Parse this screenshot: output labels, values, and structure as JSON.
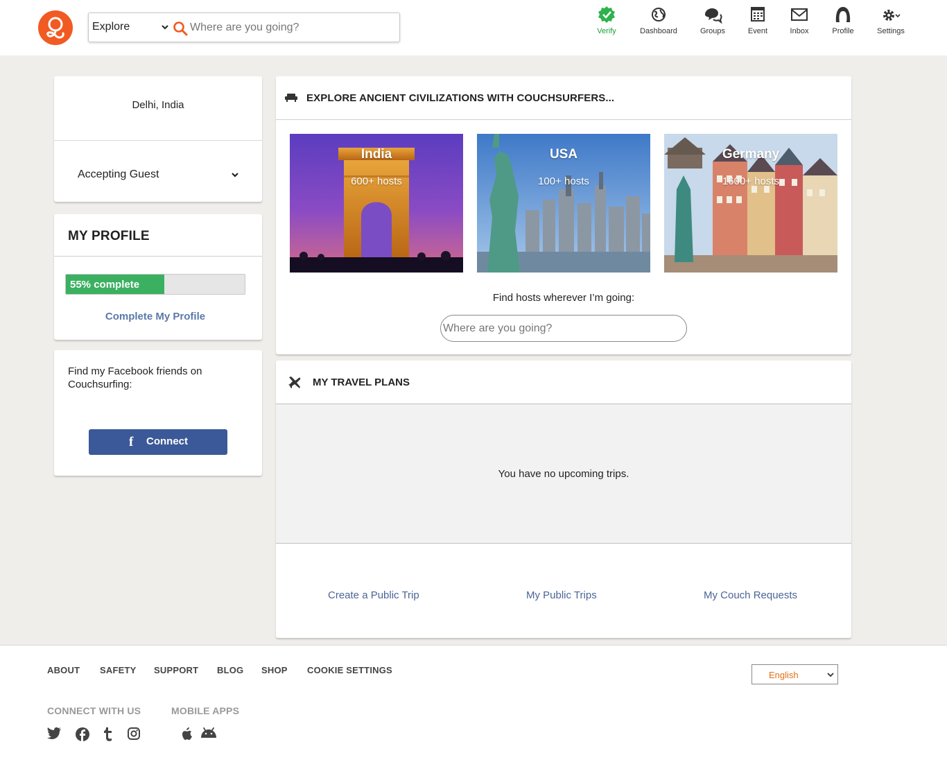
{
  "header": {
    "logo": "couchsurfing-logo",
    "search": {
      "mode_selected": "Explore",
      "placeholder": "Where are you going?"
    },
    "nav": [
      {
        "label": "Verify",
        "icon": "verify-check-icon",
        "color": "#1a9e3c"
      },
      {
        "label": "Dashboard",
        "icon": "globe-icon"
      },
      {
        "label": "Groups",
        "icon": "chat-bubbles-icon"
      },
      {
        "label": "Event",
        "icon": "calendar-icon"
      },
      {
        "label": "Inbox",
        "icon": "envelope-icon"
      },
      {
        "label": "Profile",
        "icon": "user-icon"
      },
      {
        "label": "Settings",
        "icon": "gear-icon"
      }
    ]
  },
  "sidebar": {
    "location": "Delhi, India",
    "hosting_status": "Accepting Guest",
    "profile": {
      "title": "MY PROFILE",
      "progress_percent": 55,
      "progress_label": "55% complete",
      "complete_link": "Complete My Profile"
    },
    "facebook": {
      "text": "Find my Facebook friends on Couchsurfing:",
      "button_label": "Connect"
    }
  },
  "explore": {
    "title": "EXPLORE ANCIENT CIVILIZATIONS WITH COUCHSURFERS...",
    "destinations": [
      {
        "name": "India",
        "hosts": "600+ hosts"
      },
      {
        "name": "USA",
        "hosts": "100+ hosts"
      },
      {
        "name": "Germany",
        "hosts": "1600+ hosts"
      }
    ],
    "find_label": "Find hosts wherever I’m going:",
    "find_placeholder": "Where are you going?"
  },
  "travel_plans": {
    "title": "MY TRAVEL PLANS",
    "empty_message": "You have no upcoming trips.",
    "links": [
      "Create a Public Trip",
      "My Public Trips",
      "My Couch Requests"
    ]
  },
  "footer": {
    "nav": [
      "ABOUT",
      "SAFETY",
      "SUPPORT",
      "BLOG",
      "SHOP",
      "COOKIE SETTINGS"
    ],
    "language": "English",
    "connect_heading": "CONNECT WITH US",
    "apps_heading": "MOBILE APPS",
    "social_icons": [
      "twitter-icon",
      "facebook-icon",
      "tumblr-icon",
      "instagram-icon"
    ],
    "app_icons": [
      "apple-icon",
      "android-icon"
    ]
  },
  "colors": {
    "brand": "#f15a22",
    "page_background": "#efeeea",
    "progress": "#3bb060",
    "facebook": "#3b5998",
    "link": "#4a6596"
  }
}
